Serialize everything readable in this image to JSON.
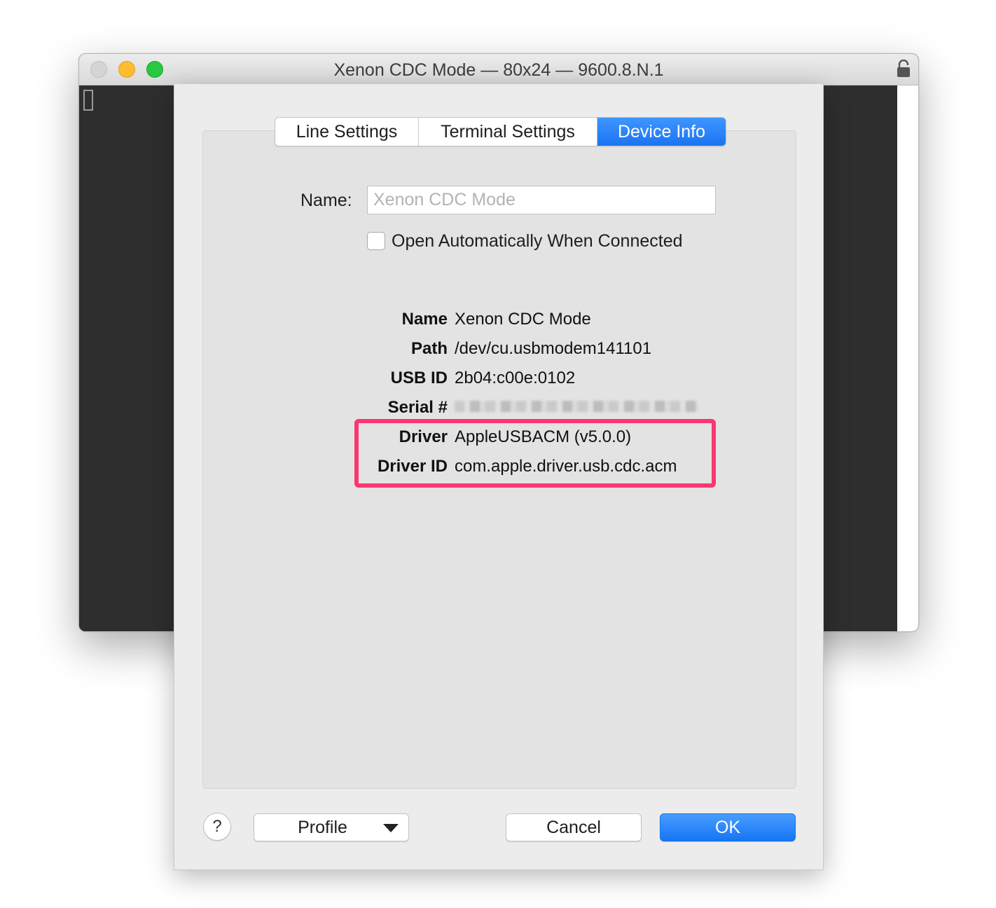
{
  "window": {
    "title": "Xenon CDC Mode — 80x24 — 9600.8.N.1"
  },
  "dialog": {
    "tabs": [
      {
        "label": "Line Settings",
        "selected": false
      },
      {
        "label": "Terminal Settings",
        "selected": false
      },
      {
        "label": "Device Info",
        "selected": true
      }
    ],
    "name_label": "Name:",
    "name_placeholder": "Xenon CDC Mode",
    "auto_open_label": "Open Automatically When Connected",
    "auto_open_checked": false,
    "device_info": {
      "name_key": "Name",
      "name_value": "Xenon CDC Mode",
      "path_key": "Path",
      "path_value": "/dev/cu.usbmodem141101",
      "usb_id_key": "USB ID",
      "usb_id_value": "2b04:c00e:0102",
      "serial_key": "Serial #",
      "driver_key": "Driver",
      "driver_value": "AppleUSBACM (v5.0.0)",
      "driver_id_key": "Driver ID",
      "driver_id_value": "com.apple.driver.usb.cdc.acm"
    },
    "highlight_color": "#fb3670",
    "footer": {
      "help_label": "?",
      "profile_label": "Profile",
      "cancel_label": "Cancel",
      "ok_label": "OK"
    },
    "accent_color": "#1a74f2"
  }
}
